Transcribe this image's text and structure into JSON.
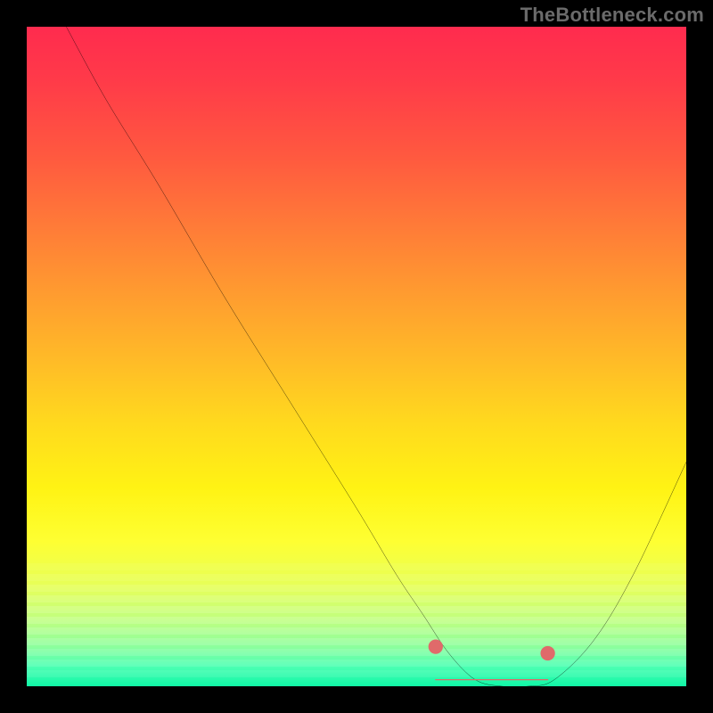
{
  "watermark": "TheBottleneck.com",
  "chart_data": {
    "type": "line",
    "title": "",
    "xlabel": "",
    "ylabel": "",
    "xlim": [
      0,
      100
    ],
    "ylim": [
      0,
      100
    ],
    "grid": false,
    "series": [
      {
        "name": "bottleneck-curve",
        "x": [
          6,
          12,
          20,
          30,
          40,
          50,
          56,
          60,
          64,
          68,
          72,
          76,
          80,
          86,
          92,
          100
        ],
        "values": [
          100,
          89,
          76,
          59,
          43,
          27,
          17,
          11,
          5,
          1,
          0,
          0,
          1,
          7,
          17,
          34
        ]
      }
    ],
    "markers": [
      {
        "name": "range-left-dot",
        "x": 62,
        "y": 6,
        "color": "#e06a6a"
      },
      {
        "name": "range-right-dot",
        "x": 79,
        "y": 5,
        "color": "#e06a6a"
      }
    ],
    "flat_segment": {
      "x0": 62,
      "x1": 79,
      "y": 1,
      "color": "#e06a6a"
    },
    "background": {
      "gradient_stops": [
        {
          "pos": 0,
          "color": "#ff2b4e"
        },
        {
          "pos": 50,
          "color": "#ffb928"
        },
        {
          "pos": 78,
          "color": "#feff32"
        },
        {
          "pos": 100,
          "color": "#10f7a6"
        }
      ]
    }
  }
}
